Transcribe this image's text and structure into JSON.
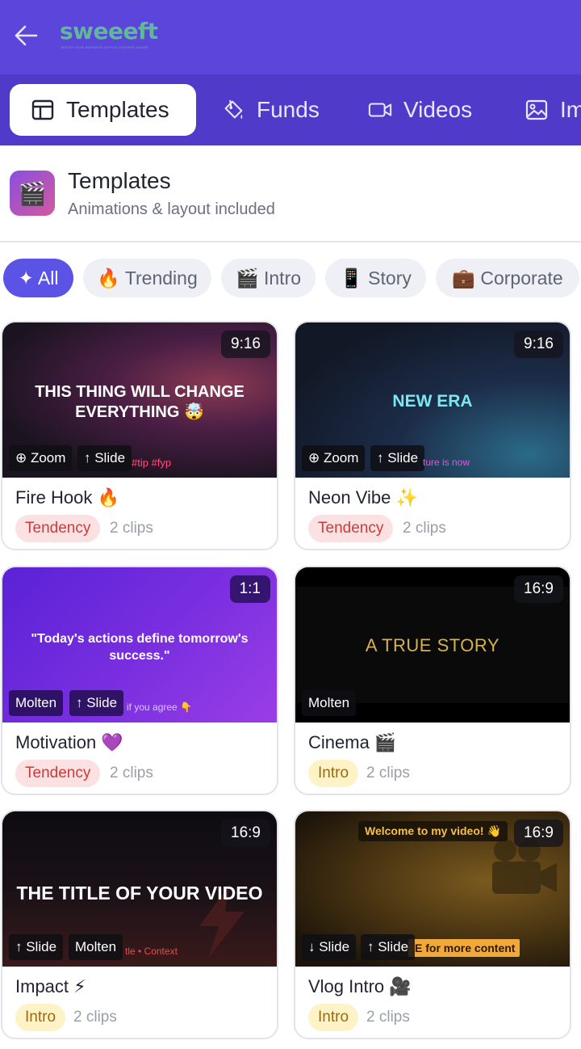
{
  "header": {
    "logo_text": "sweeeft",
    "logo_tagline": "BOOST YOUR BUSINESS WITH AI CONTENT MAKER"
  },
  "tabs": [
    {
      "label": "Templates",
      "icon": "layout-icon",
      "active": true
    },
    {
      "label": "Funds",
      "icon": "paint-bucket-icon",
      "active": false
    },
    {
      "label": "Videos",
      "icon": "video-camera-icon",
      "active": false
    },
    {
      "label": "Im",
      "icon": "image-icon",
      "active": false
    }
  ],
  "section": {
    "icon": "🎬",
    "title": "Templates",
    "subtitle": "Animations & layout included"
  },
  "filters": [
    {
      "label": "✦ All",
      "active": true
    },
    {
      "label": "🔥 Trending",
      "active": false
    },
    {
      "label": "🎬 Intro",
      "active": false
    },
    {
      "label": "📱 Story",
      "active": false
    },
    {
      "label": "💼 Corporate",
      "active": false
    }
  ],
  "cards": [
    {
      "title": "Fire Hook 🔥",
      "ratio": "9:16",
      "badge": "Tendency",
      "clips": "2 clips",
      "overlay": "THIS THING WILL CHANGE EVERYTHING 🤯",
      "small_text": "#tip #fyp",
      "tags": [
        "⊕ Zoom",
        "↑ Slide"
      ]
    },
    {
      "title": "Neon Vibe ✨",
      "ratio": "9:16",
      "badge": "Tendency",
      "clips": "2 clips",
      "overlay": "NEW ERA",
      "small_text": "ture is now",
      "tags": [
        "⊕ Zoom",
        "↑ Slide"
      ]
    },
    {
      "title": "Motivation 💜",
      "ratio": "1:1",
      "badge": "Tendency",
      "clips": "2 clips",
      "overlay": "\"Today's actions define tomorrow's success.\"",
      "small_text": "if you agree 👇",
      "tags": [
        "Molten",
        "↑ Slide"
      ]
    },
    {
      "title": "Cinema 🎬",
      "ratio": "16:9",
      "badge": "Intro",
      "clips": "2 clips",
      "overlay": "A TRUE STORY",
      "small_text": "",
      "tags": [
        "Molten"
      ]
    },
    {
      "title": "Impact ⚡",
      "ratio": "16:9",
      "badge": "Intro",
      "clips": "2 clips",
      "overlay": "THE TITLE OF YOUR VIDEO",
      "small_text": "tle • Context",
      "tags": [
        "↑ Slide",
        "Molten"
      ]
    },
    {
      "title": "Vlog Intro 🎥",
      "ratio": "16:9",
      "badge": "Intro",
      "clips": "2 clips",
      "overlay": "Welcome to my video! 👋",
      "small_text": "E for more content",
      "tags": [
        "↓ Slide",
        "↑ Slide"
      ]
    }
  ],
  "colors": {
    "header_bg": "#5b45db",
    "tabs_bg": "#4f3ac9",
    "accent": "#5b53e6"
  }
}
